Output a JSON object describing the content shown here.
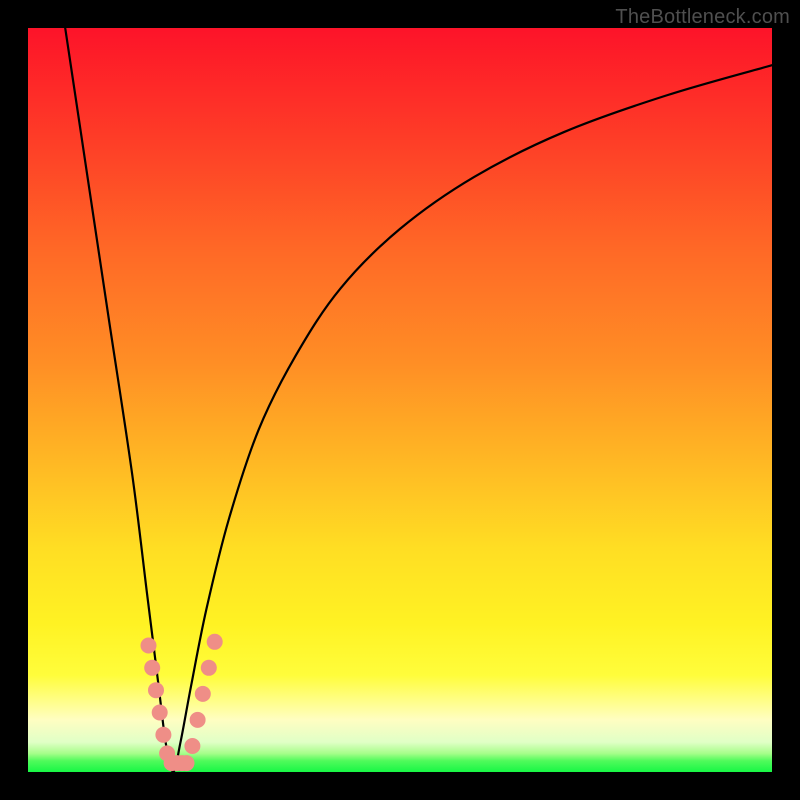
{
  "watermark": "TheBottleneck.com",
  "chart_data": {
    "type": "line",
    "title": "",
    "xlabel": "",
    "ylabel": "",
    "xlim": [
      0,
      100
    ],
    "ylim": [
      0,
      100
    ],
    "series": [
      {
        "name": "bottleneck-curve",
        "x": [
          5,
          8,
          11,
          14,
          16,
          17.5,
          18.5,
          19.5,
          20.5,
          22,
          24,
          27,
          31,
          36,
          42,
          50,
          60,
          72,
          86,
          100
        ],
        "values": [
          100,
          80,
          60,
          40,
          24,
          12,
          4,
          0,
          4,
          12,
          22,
          34,
          46,
          56,
          65,
          73,
          80,
          86,
          91,
          95
        ]
      }
    ],
    "markers": {
      "name": "highlight-dots",
      "color": "#ef8e87",
      "points": [
        {
          "x": 16.2,
          "y": 17
        },
        {
          "x": 16.7,
          "y": 14
        },
        {
          "x": 17.2,
          "y": 11
        },
        {
          "x": 17.7,
          "y": 8
        },
        {
          "x": 18.2,
          "y": 5
        },
        {
          "x": 18.7,
          "y": 2.5
        },
        {
          "x": 19.3,
          "y": 1.2
        },
        {
          "x": 20.0,
          "y": 1.2
        },
        {
          "x": 20.7,
          "y": 1.2
        },
        {
          "x": 21.3,
          "y": 1.2
        },
        {
          "x": 22.1,
          "y": 3.5
        },
        {
          "x": 22.8,
          "y": 7
        },
        {
          "x": 23.5,
          "y": 10.5
        },
        {
          "x": 24.3,
          "y": 14
        },
        {
          "x": 25.1,
          "y": 17.5
        }
      ]
    }
  }
}
